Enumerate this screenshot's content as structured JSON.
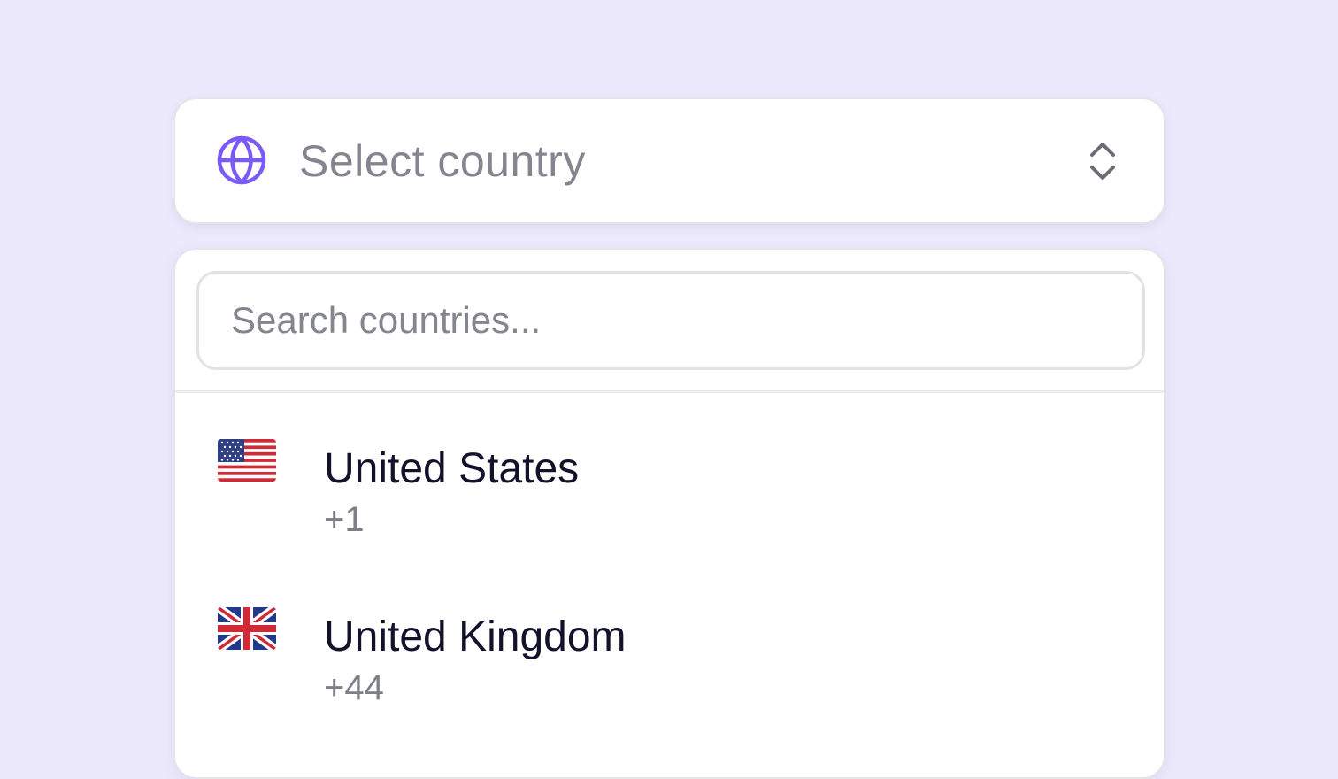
{
  "colors": {
    "background": "#ede9fc",
    "accent": "#7a5af8",
    "placeholder": "#84858f",
    "text_primary": "#12122a",
    "text_secondary": "#7d7e88"
  },
  "select": {
    "icon": "globe-icon",
    "placeholder": "Select country",
    "chevron_icon": "chevron-up-down-icon"
  },
  "dropdown": {
    "search": {
      "value": "",
      "placeholder": "Search countries..."
    },
    "items": [
      {
        "flag_icon": "us-flag-icon",
        "name": "United States",
        "dial_code": "+1"
      },
      {
        "flag_icon": "uk-flag-icon",
        "name": "United Kingdom",
        "dial_code": "+44"
      }
    ]
  }
}
